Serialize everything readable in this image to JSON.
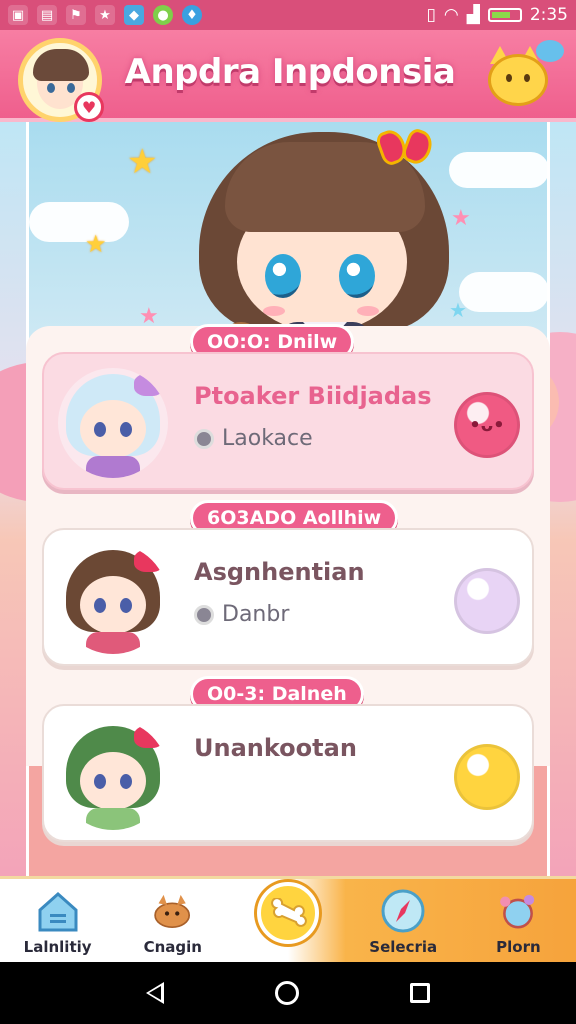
{
  "status_bar": {
    "time": "2:35",
    "left_icons": [
      "image-icon",
      "document-icon",
      "flag-icon",
      "star-icon",
      "shield-icon",
      "circle-app-icon",
      "drop-icon"
    ],
    "right_icons": [
      "vibrate-icon",
      "wifi-icon",
      "signal-icon",
      "battery-icon"
    ]
  },
  "header": {
    "title": "Anpdra Inpdonsia"
  },
  "list": [
    {
      "tag": "OO:O: Dnilw",
      "title": "Ptoaker Biidjadas",
      "subtitle": "Laokace",
      "active": true,
      "hair_color": "#cfe9f7",
      "bow_color": "#c58be0",
      "shirt_color": "#b07ad0",
      "button_color": "#f05a83",
      "button_face": "•ᴗ•"
    },
    {
      "tag": "6O3ADO Aollhiw",
      "title": "Asgnhentian",
      "subtitle": "Danbr",
      "active": false,
      "hair_color": "#6b4834",
      "bow_color": "#e8375e",
      "shirt_color": "#e05a7a",
      "button_color": "#e8d4f5",
      "button_face": ""
    },
    {
      "tag": "O0-3: Dalneh",
      "title": "Unankootan",
      "subtitle": "",
      "active": false,
      "hair_color": "#4f8a4a",
      "bow_color": "#e8375e",
      "shirt_color": "#8bc47a",
      "button_color": "#ffd43f",
      "button_face": ""
    }
  ],
  "bottom_nav": [
    {
      "label": "Lalnlitiy",
      "icon": "house-icon"
    },
    {
      "label": "Cnagin",
      "icon": "fox-icon"
    },
    {
      "label": "",
      "icon": "bone-icon"
    },
    {
      "label": "Selecria",
      "icon": "compass-icon"
    },
    {
      "label": "Plorn",
      "icon": "potion-icon"
    }
  ],
  "colors": {
    "accent": "#ee5f8d",
    "header": "#f77ea3",
    "nav_highlight": "#f6a33c"
  }
}
